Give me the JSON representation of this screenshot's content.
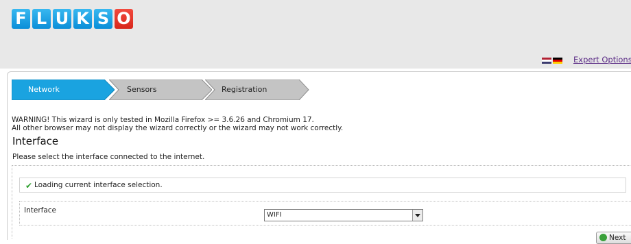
{
  "header": {
    "logo_letters": [
      "F",
      "L",
      "U",
      "K",
      "S",
      "O"
    ],
    "expert_options": "Expert Options",
    "language_flags": [
      "english-flag-icon",
      "german-flag-icon"
    ]
  },
  "wizard": {
    "steps": [
      {
        "label": "Network",
        "active": true
      },
      {
        "label": "Sensors",
        "active": false
      },
      {
        "label": "Registration",
        "active": false
      }
    ]
  },
  "warning": {
    "line1": "WARNING! This wizard is only tested in Mozilla Firefox >= 3.6.26 and Chromium 17.",
    "line2": "All other browser may not display the wizard correctly or the wizard may not work correctly."
  },
  "section": {
    "title": "Interface",
    "description": "Please select the interface connected to the internet."
  },
  "status": {
    "icon": "checkmark-icon",
    "text": "Loading current interface selection."
  },
  "form": {
    "interface_label": "Interface",
    "interface_value": "WIFI"
  },
  "actions": {
    "next_label": "Next"
  },
  "colors": {
    "active_step": "#1aa3e0",
    "inactive_step": "#c4c4c4",
    "brand_blue": "#1a9ee0",
    "brand_red": "#e33b2f"
  }
}
